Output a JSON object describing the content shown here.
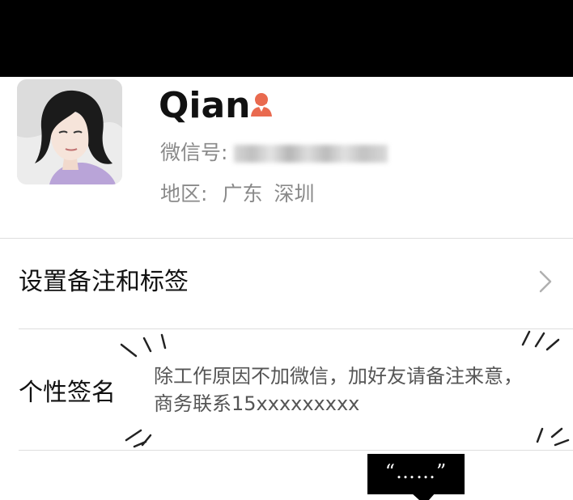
{
  "profile": {
    "name": "Qian",
    "gender_icon": "female-user-icon",
    "wechat_id_label": "微信号:",
    "wechat_id_value": "redacted",
    "region_label": "地区:",
    "region_province": "广东",
    "region_city": "深圳"
  },
  "menu": {
    "set_remark_label": "设置备注和标签",
    "chevron_icon": "chevron-right-icon"
  },
  "signature": {
    "label": "个性签名",
    "line1": "除工作原因不加微信，加好友请备注来意，",
    "line2": "商务联系15xxxxxxxxx"
  },
  "comic": {
    "bubble_text": "“……”"
  },
  "colors": {
    "top_bar": "#000000",
    "gender_icon": "#e96a4f",
    "secondary_text": "#8a8a8a",
    "divider": "#dedede"
  }
}
